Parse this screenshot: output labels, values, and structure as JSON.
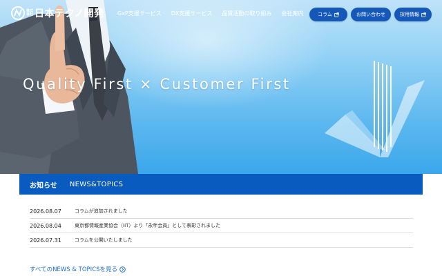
{
  "header": {
    "logo_small_1": "株式",
    "logo_small_2": "会社",
    "logo_text": "日本テクノ開発",
    "logo_sub": "NTED",
    "nav": [
      {
        "label": "GxP支援サービス"
      },
      {
        "label": "DX支援サービス"
      },
      {
        "label": "品質活動の取り組み"
      },
      {
        "label": "会社案内"
      }
    ],
    "buttons": [
      {
        "label": "コラム",
        "icon": "external-link-icon"
      },
      {
        "label": "お問い合わせ"
      },
      {
        "label": "採用情報",
        "icon": "external-link-icon"
      }
    ]
  },
  "hero": {
    "title": "Quality First × Customer First"
  },
  "news": {
    "heading_jp": "お知らせ",
    "heading_en": "NEWS&TOPICS",
    "items": [
      {
        "date": "2026.08.07",
        "title": "コラムが追加されました"
      },
      {
        "date": "2026.08.04",
        "title": "東京都情報産業協会（IIT）より「永年会員」として表彰されました"
      },
      {
        "date": "2026.07.31",
        "title": "コラムを公開いたしました"
      }
    ],
    "all_link": "すべてのNEWS & TOPICSを見る"
  },
  "colors": {
    "brand_blue": "#0a5bbf",
    "pill_blue": "#1558b8",
    "link_blue": "#1a6fd6",
    "sky_top": "#bfe3f9",
    "sky_bottom": "#3ba7eb"
  }
}
